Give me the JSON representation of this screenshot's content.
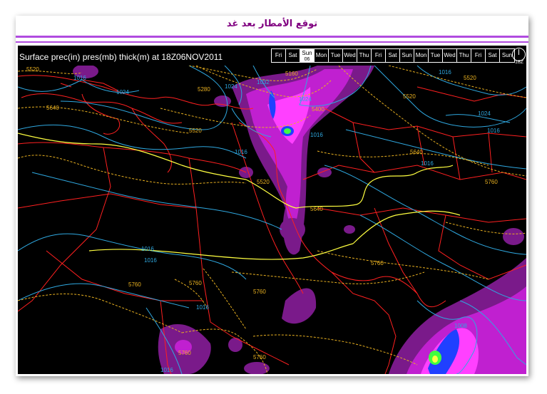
{
  "page_title": "توقع الأمطار بعد غد",
  "map": {
    "caption": "Surface prec(in) pres(mb) thick(m) at 18Z06NOV2011",
    "days": [
      {
        "label": "Fri",
        "sub": "",
        "active": false
      },
      {
        "label": "Sat",
        "sub": "",
        "active": false
      },
      {
        "label": "Sun",
        "sub": "06",
        "active": true
      },
      {
        "label": "Mon",
        "sub": "",
        "active": false
      },
      {
        "label": "Tue",
        "sub": "",
        "active": false
      },
      {
        "label": "Wed",
        "sub": "",
        "active": false
      },
      {
        "label": "Thu",
        "sub": "",
        "active": false
      },
      {
        "label": "Fri",
        "sub": "",
        "active": false
      },
      {
        "label": "Sat",
        "sub": "",
        "active": false
      },
      {
        "label": "Sun",
        "sub": "",
        "active": false
      },
      {
        "label": "Mon",
        "sub": "",
        "active": false
      },
      {
        "label": "Tue",
        "sub": "",
        "active": false
      },
      {
        "label": "Wed",
        "sub": "",
        "active": false
      },
      {
        "label": "Thu",
        "sub": "",
        "active": false
      },
      {
        "label": "Fri",
        "sub": "",
        "active": false
      },
      {
        "label": "Sat",
        "sub": "",
        "active": false
      },
      {
        "label": "Sun",
        "sub": "",
        "active": false
      }
    ],
    "time_label": "18Z",
    "colors": {
      "background": "#000000",
      "borders": "#ff2020",
      "pressure_isobars": "#2fa8e0",
      "thickness_contours": "#e8b020",
      "thickness_5640": "#ffff40",
      "precip_light": "#7a1a8a",
      "precip_medium": "#c020d0",
      "precip_heavy": "#ff40ff",
      "precip_core": "#2040ff",
      "precip_peak": "#40ff40"
    },
    "contour_labels": {
      "thickness": [
        "5520",
        "5160",
        "5520",
        "5640",
        "5280",
        "5400",
        "5520",
        "5520",
        "5640",
        "5520",
        "5760",
        "5640",
        "5760",
        "5760",
        "5760",
        "5760",
        "5760",
        "5760"
      ],
      "pressure": [
        "1016",
        "1024",
        "1024",
        "1032",
        "1024",
        "1016",
        "1024",
        "1016",
        "1016",
        "1016",
        "1016",
        "1016",
        "1016",
        "1016",
        "1008",
        "1016"
      ]
    }
  }
}
